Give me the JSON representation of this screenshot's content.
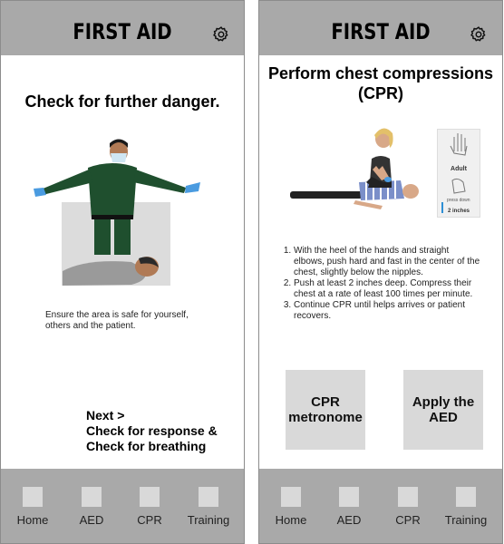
{
  "app": {
    "title": "FIRST AID"
  },
  "nav": [
    {
      "label": "Home"
    },
    {
      "label": "AED"
    },
    {
      "label": "CPR"
    },
    {
      "label": "Training"
    }
  ],
  "screen_left": {
    "heading": "Check for further danger.",
    "description": "Ensure the area is safe for yourself, others and the patient.",
    "next": {
      "line1": "Next >",
      "line2": "Check for response &",
      "line3": "Check for breathing"
    }
  },
  "screen_right": {
    "heading": "Perform chest compressions (CPR)",
    "adult_card": {
      "label": "Adult",
      "press": "press down",
      "depth": "2 inches"
    },
    "steps": [
      "With the heel of the hands and straight elbows, push hard and fast in the center of the chest, slightly below the nipples.",
      "Push at least 2 inches deep. Compress their chest at a rate of least 100 times per minute.",
      "Continue CPR until helps arrives or patient recovers."
    ],
    "buttons": {
      "metronome": "CPR metronome",
      "aed": "Apply the AED"
    }
  },
  "colors": {
    "bar": "#a9a9a9",
    "placeholder": "#d9d9d9",
    "uniform": "#1f4f2e",
    "glove": "#4a9be0",
    "shirt": "#7b8fc9"
  },
  "icons": {
    "settings": "gear-icon",
    "nav": "nav-placeholder-icon"
  }
}
